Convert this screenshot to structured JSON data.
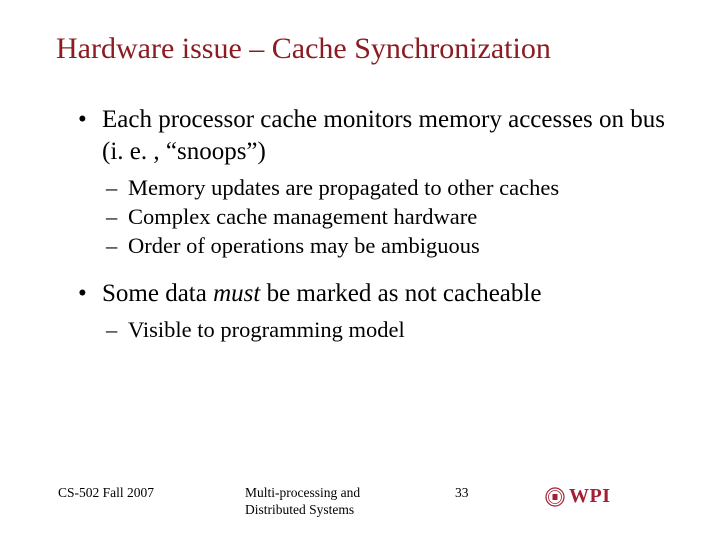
{
  "title": "Hardware issue – Cache Synchronization",
  "bullets": [
    {
      "text": "Each processor cache monitors memory accesses on bus (i. e. , “snoops”)",
      "subs": [
        "Memory updates are propagated to other caches",
        "Complex cache management hardware",
        "Order of operations may be ambiguous"
      ]
    },
    {
      "text_pre": "Some data ",
      "text_em": "must",
      "text_post": " be marked as not cacheable",
      "subs": [
        "Visible to programming model"
      ]
    }
  ],
  "footer": {
    "left": "CS-502 Fall 2007",
    "center": "Multi-processing and\nDistributed Systems",
    "page": "33",
    "logo": "WPI"
  }
}
